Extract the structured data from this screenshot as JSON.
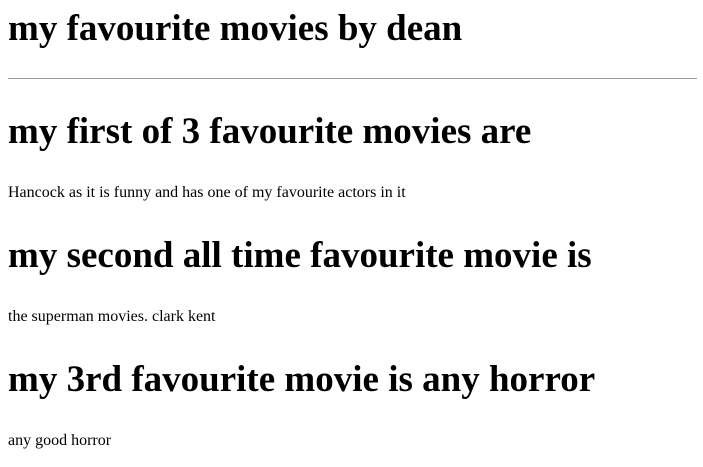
{
  "page": {
    "title": "my favourite movies by dean"
  },
  "sections": [
    {
      "heading": "my first of 3 favourite movies are",
      "text": "Hancock as it is funny and has one of my favourite actors in it"
    },
    {
      "heading": "my second all time favourite movie is",
      "text": "the superman movies. clark kent"
    },
    {
      "heading": "my 3rd favourite movie is any horror",
      "text": "any good horror"
    }
  ]
}
